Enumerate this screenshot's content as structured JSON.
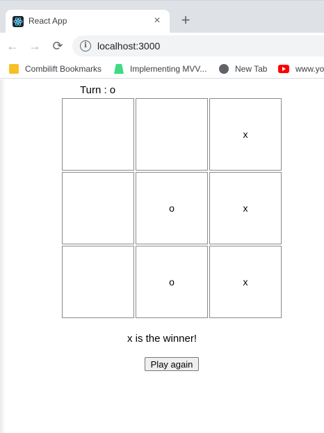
{
  "browser": {
    "tab_title": "React App",
    "tab_close": "×",
    "new_tab": "+",
    "url": "localhost:3000",
    "nav": {
      "back": "←",
      "forward": "→",
      "reload": "⟳"
    },
    "bookmarks": [
      {
        "label": "Combilift Bookmarks",
        "icon": "folder-icon"
      },
      {
        "label": "Implementing MVV...",
        "icon": "android-icon"
      },
      {
        "label": "New Tab",
        "icon": "globe-icon"
      },
      {
        "label": "www.yo",
        "icon": "youtube-icon"
      }
    ]
  },
  "game": {
    "turn_label": "Turn : o",
    "cells": [
      "",
      "",
      "x",
      "",
      "o",
      "x",
      "",
      "o",
      "x"
    ],
    "status": "x is the winner!",
    "play_again_label": "Play again"
  }
}
